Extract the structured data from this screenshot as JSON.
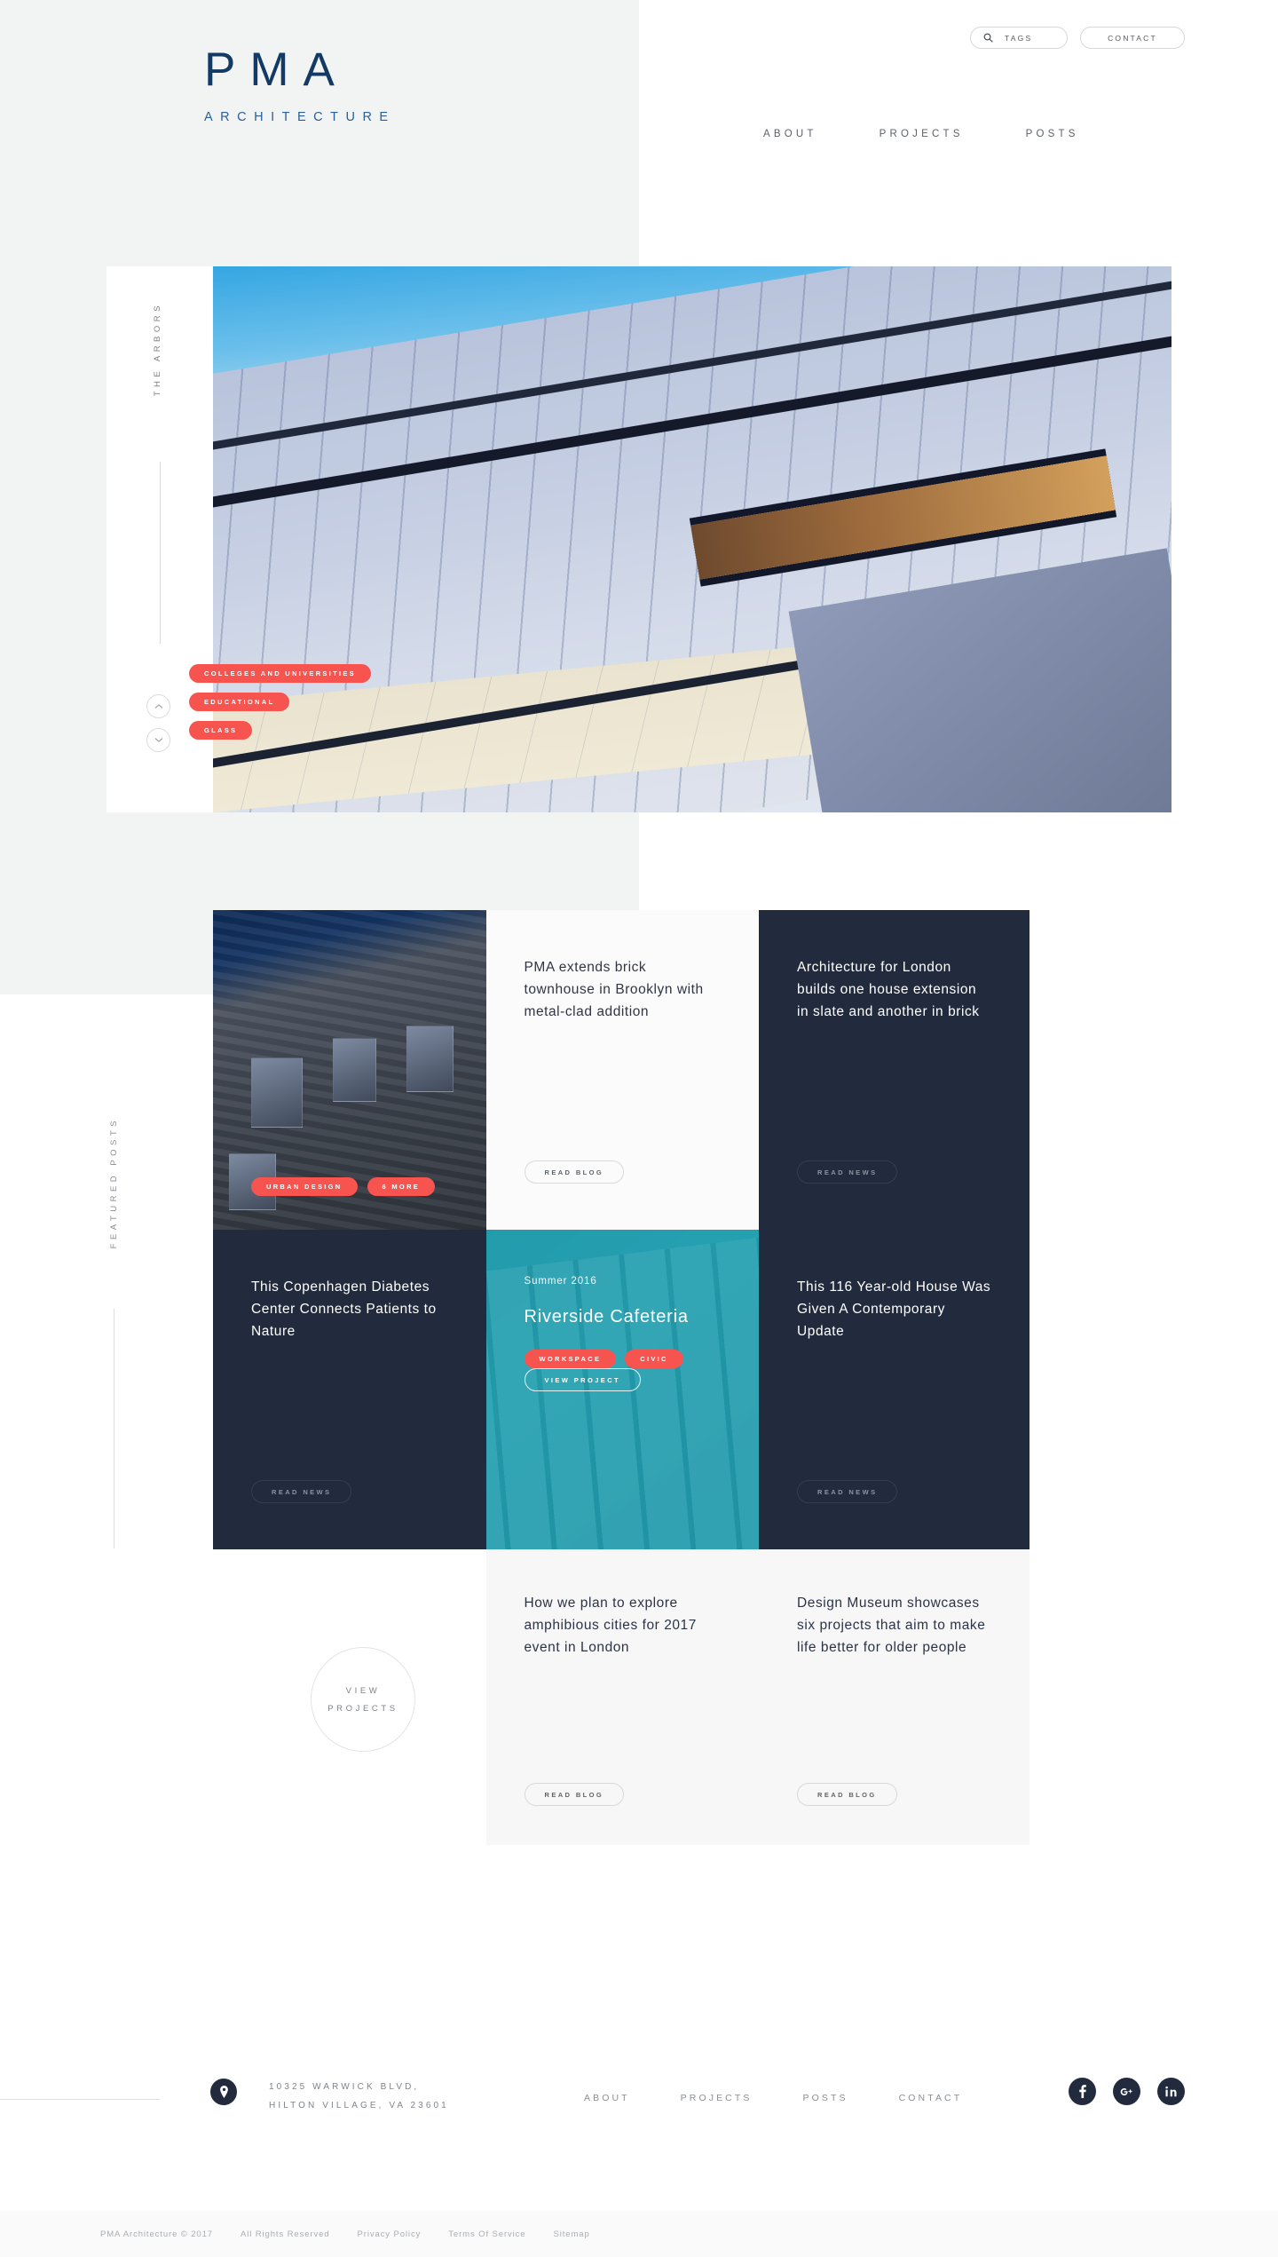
{
  "brand": {
    "logo": "PMA",
    "tagline": "ARCHITECTURE",
    "logo_color": "#123a63",
    "tagline_color": "#2b6096"
  },
  "topbar": {
    "tags_label": "TAGS",
    "contact_label": "CONTACT",
    "search_icon": "search-icon"
  },
  "mainnav": {
    "items": [
      {
        "label": "ABOUT"
      },
      {
        "label": "PROJECTS"
      },
      {
        "label": "POSTS"
      }
    ]
  },
  "hero": {
    "side_label": "THE ARBORS",
    "tags": [
      {
        "label": "COLLEGES AND UNIVERSITIES"
      },
      {
        "label": "EDUCATIONAL"
      },
      {
        "label": "GLASS"
      }
    ],
    "prev_icon": "chevron-up-icon",
    "next_icon": "chevron-down-icon"
  },
  "featured": {
    "section_label": "FEATURED POSTS",
    "cards": {
      "photo_townhouse": {
        "tags": [
          {
            "label": "URBAN DESIGN"
          },
          {
            "label": "6 MORE"
          }
        ]
      },
      "brick_townhouse": {
        "title": "PMA extends brick townhouse in Brooklyn with metal-clad addition",
        "cta": "READ BLOG"
      },
      "london_builds": {
        "title": "Architecture for London builds one house extension in slate and another in brick",
        "cta": "READ NEWS"
      },
      "copenhagen": {
        "title": "This Copenhagen Diabetes Center Connects Patients to Nature",
        "cta": "READ NEWS"
      },
      "riverside": {
        "eyebrow": "Summer 2016",
        "title": "Riverside Cafeteria",
        "tags": [
          {
            "label": "WORKSPACE"
          },
          {
            "label": "CIVIC"
          }
        ],
        "cta": "VIEW PROJECT"
      },
      "year_old_house": {
        "title": "This 116 Year-old House Was Given A Contemporary Update",
        "cta": "READ NEWS"
      },
      "amphibious": {
        "title": "How we plan to explore amphibious cities for 2017 event in London",
        "cta": "READ BLOG"
      },
      "design_museum": {
        "title": "Design Museum showcases six projects that aim to make life better for older people",
        "cta": "READ BLOG"
      }
    },
    "view_projects": {
      "line1": "VIEW",
      "line2": "PROJECTS"
    }
  },
  "footer": {
    "address_line1": "10325 WARWICK BLVD,",
    "address_line2": "HILTON VILLAGE, VA 23601",
    "location_icon": "map-pin-icon",
    "nav": [
      {
        "label": "ABOUT"
      },
      {
        "label": "PROJECTS"
      },
      {
        "label": "POSTS"
      },
      {
        "label": "CONTACT"
      }
    ],
    "socials": [
      {
        "name": "facebook-icon",
        "glyph": "f"
      },
      {
        "name": "google-plus-icon",
        "glyph": "g+"
      },
      {
        "name": "linkedin-icon",
        "glyph": "in"
      }
    ],
    "copyright": "PMA Architecture © 2017",
    "legal": [
      {
        "label": "All Rights Reserved"
      },
      {
        "label": "Privacy Policy"
      },
      {
        "label": "Terms Of Service"
      },
      {
        "label": "Sitemap"
      }
    ]
  },
  "colors": {
    "accent_red": "#f7544f",
    "dark_navy": "#222a3d",
    "teal": "#2aa5b5",
    "page_grey": "#f2f3f3"
  }
}
